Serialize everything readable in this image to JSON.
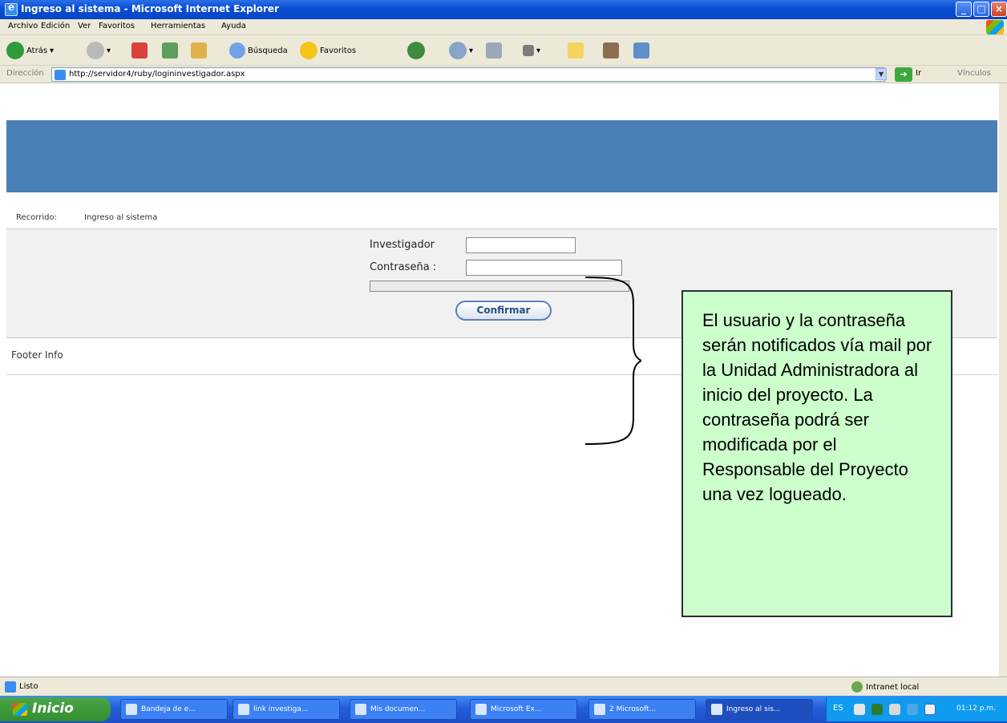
{
  "window": {
    "title": "Ingreso al sistema - Microsoft Internet Explorer"
  },
  "menubar": {
    "items": [
      "Archivo",
      "Edición",
      "Ver",
      "Favoritos",
      "Herramientas",
      "Ayuda"
    ]
  },
  "toolbar": {
    "back_label": "Atrás",
    "search_label": "Búsqueda",
    "favorites_label": "Favoritos"
  },
  "address": {
    "label": "Dirección",
    "url": "http://servidor4/ruby/logininvestigador.aspx",
    "go_label": "Ir",
    "links_label": "Vínculos"
  },
  "page": {
    "breadcrumb_label": "Recorrido:",
    "breadcrumb_value": "Ingreso al sistema",
    "investigador_label": "Investigador",
    "investigador_value": "",
    "password_label": "Contraseña :",
    "password_value": "",
    "confirm_label": "Confirmar",
    "footer_text": "Footer Info"
  },
  "callout": {
    "text": "El usuario y la contraseña serán notificados vía mail por la Unidad Administradora al inicio del proyecto. La contraseña podrá ser modificada por el Responsable del Proyecto una vez logueado."
  },
  "statusbar": {
    "status_text": "Listo",
    "zone_text": "Intranet local"
  },
  "taskbar": {
    "start_label": "Inicio",
    "tasks": [
      "Bandeja de e...",
      "link investiga...",
      "Mis documen...",
      "Microsoft Ex...",
      "2 Microsoft...",
      "Ingreso al sis..."
    ],
    "language": "ES",
    "clock": "01:12 p.m."
  },
  "colors": {
    "banner": "#4a80b7",
    "callout_bg": "#ccffcc",
    "titlebar": "#0a4fd6"
  }
}
